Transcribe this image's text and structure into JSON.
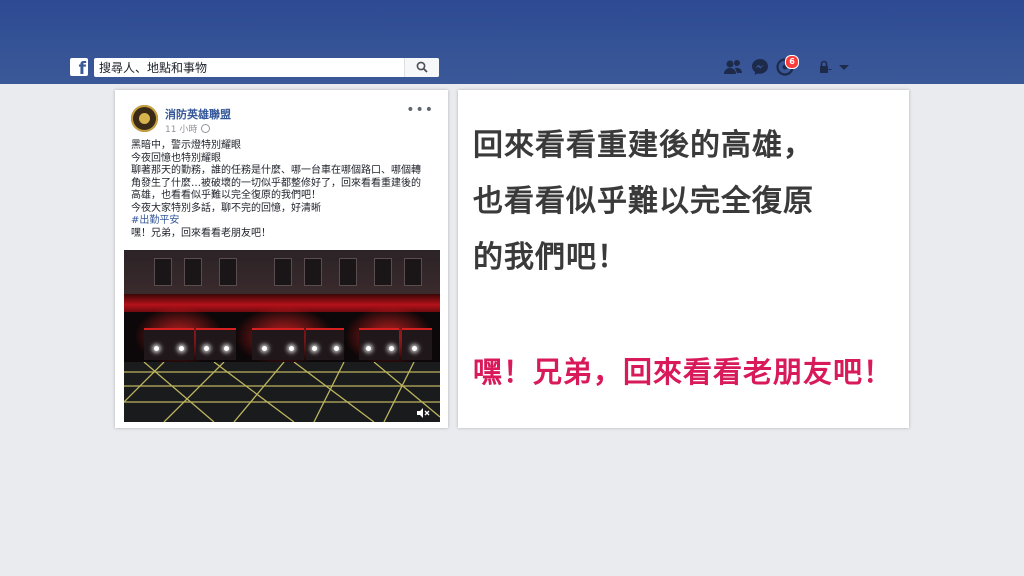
{
  "header": {
    "logo": "f",
    "search_placeholder": "搜尋人、地點和事物",
    "notification_count": "6",
    "icons": [
      "friends-icon",
      "messenger-icon",
      "notifications-icon",
      "privacy-lock-icon",
      "dropdown-caret-icon"
    ]
  },
  "post": {
    "author": "消防英雄聯盟",
    "time": "11 小時",
    "lines": [
      "黑暗中，警示燈特別耀眼",
      "今夜回憶也特別耀眼",
      "聊著那天的勤務，誰的任務是什麼、哪一台車在哪個路口、哪個轉",
      "角發生了什麼…被破壞的一切似乎都整修好了，回來看看重建後的",
      "高雄，也看看似乎難以完全復原的我們吧！",
      "今夜大家特別多話，聊不完的回憶，好清晰"
    ],
    "hashtag": "#出勤平安",
    "last_line": "嘿！兄弟，回來看看老朋友吧！"
  },
  "quote": {
    "lines": [
      "回來看看重建後的高雄，",
      "也看看似乎難以完全復原",
      "的我們吧！"
    ],
    "highlight": "嘿！兄弟，回來看看老朋友吧！"
  },
  "colors": {
    "topbar": "#3b5998",
    "link": "#365899",
    "highlight": "#d91a5a"
  }
}
